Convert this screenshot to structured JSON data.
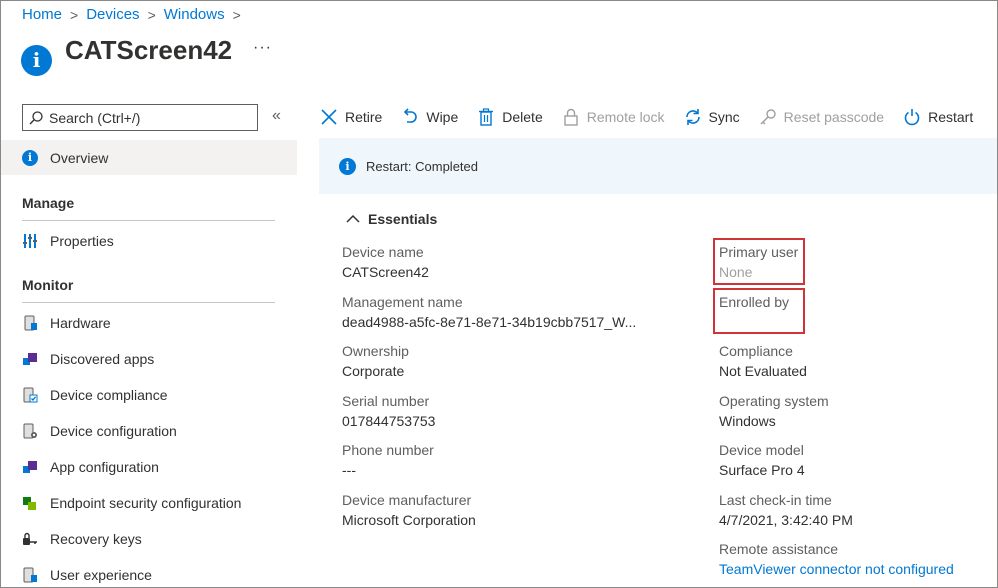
{
  "breadcrumb": {
    "items": [
      "Home",
      "Devices",
      "Windows"
    ]
  },
  "title": "CATScreen42",
  "more_label": "···",
  "sidebar": {
    "search_placeholder": "Search (Ctrl+/)",
    "collapse_glyph": "«",
    "overview": "Overview",
    "sections": [
      {
        "title": "Manage",
        "items": [
          {
            "label": "Properties",
            "icon": "properties-icon"
          }
        ]
      },
      {
        "title": "Monitor",
        "items": [
          {
            "label": "Hardware",
            "icon": "hardware-icon"
          },
          {
            "label": "Discovered apps",
            "icon": "apps-icon"
          },
          {
            "label": "Device compliance",
            "icon": "compliance-icon"
          },
          {
            "label": "Device configuration",
            "icon": "configuration-icon"
          },
          {
            "label": "App configuration",
            "icon": "app-config-icon"
          },
          {
            "label": "Endpoint security configuration",
            "icon": "endpoint-security-icon"
          },
          {
            "label": "Recovery keys",
            "icon": "key-icon"
          },
          {
            "label": "User experience",
            "icon": "user-experience-icon"
          }
        ]
      }
    ]
  },
  "toolbar": {
    "retire": "Retire",
    "wipe": "Wipe",
    "delete": "Delete",
    "remote_lock": "Remote lock",
    "sync": "Sync",
    "reset_passcode": "Reset passcode",
    "restart": "Restart"
  },
  "notice": {
    "text": "Restart: Completed"
  },
  "essentials": {
    "title": "Essentials",
    "left": [
      {
        "label": "Device name",
        "value": "CATScreen42"
      },
      {
        "label": "Management name",
        "value": "dead4988-a5fc-8e71-8e71-34b19cbb7517_W..."
      },
      {
        "label": "Ownership",
        "value": "Corporate"
      },
      {
        "label": "Serial number",
        "value": "017844753753"
      },
      {
        "label": "Phone number",
        "value": "---"
      },
      {
        "label": "Device manufacturer",
        "value": "Microsoft Corporation"
      }
    ],
    "right": [
      {
        "label": "Primary user",
        "value": "None"
      },
      {
        "label": "Enrolled by",
        "value": ""
      },
      {
        "label": "Compliance",
        "value": "Not Evaluated"
      },
      {
        "label": "Operating system",
        "value": "Windows"
      },
      {
        "label": "Device model",
        "value": "Surface Pro 4"
      },
      {
        "label": "Last check-in time",
        "value": "4/7/2021, 3:42:40 PM"
      },
      {
        "label": "Remote assistance",
        "value": "TeamViewer connector not configured"
      }
    ]
  },
  "colors": {
    "accent": "#0078d4",
    "highlight": "#d13438",
    "notice_bg": "#eff6fc",
    "nav_selected": "#f3f2f1"
  }
}
